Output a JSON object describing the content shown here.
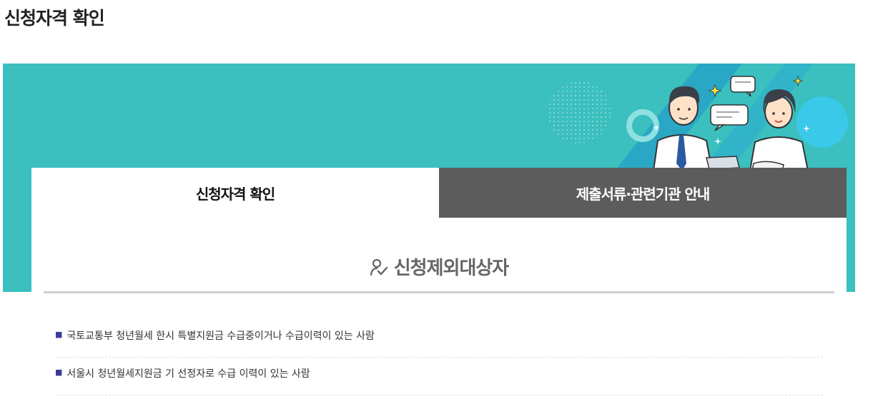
{
  "page": {
    "title": "신청자격 확인"
  },
  "tabs": [
    {
      "label": "신청자격 확인",
      "active": true
    },
    {
      "label": "제출서류·관련기관 안내",
      "active": false
    }
  ],
  "section": {
    "heading": "신청제외대상자",
    "icon": "person-check-icon"
  },
  "exclusions": [
    "국토교통부 청년월세 한시 특별지원금 수급중이거나 수급이력이 있는 사람",
    "서울시 청년월세지원금 기 선정자로 수급 이력이 있는 사람"
  ],
  "colors": {
    "banner": "#3bbfbf",
    "tab_inactive": "#5c5c5c",
    "bullet": "#3a3a9a"
  }
}
